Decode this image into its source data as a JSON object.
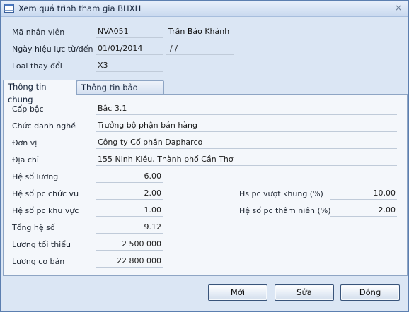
{
  "window": {
    "title": "Xem quá trình tham gia BHXH",
    "close_icon": "×"
  },
  "header": {
    "employee_code_label": "Mã nhân viên",
    "employee_code": "NVA051",
    "employee_name": "Trần Bảo Khánh",
    "effective_date_label": "Ngày hiệu lực từ/đến",
    "effective_from": "01/01/2014",
    "effective_to": "/ /",
    "change_type_label": "Loại thay đổi",
    "change_type": "X3"
  },
  "tabs": [
    {
      "label": "Thông tin chung",
      "active": true
    },
    {
      "label": "Thông tin bảo hiểm",
      "active": false
    }
  ],
  "general": {
    "rank_label": "Cấp bậc",
    "rank": "Bậc 3.1",
    "job_title_label": "Chức danh nghề",
    "job_title": "Trưởng bộ phận bán hàng",
    "unit_label": "Đơn vị",
    "unit": "Công ty Cổ phần Dapharco",
    "address_label": "Địa chỉ",
    "address": "155 Ninh Kiều, Thành phố Cần Thơ",
    "salary_coef_label": "Hệ số lương",
    "salary_coef": "6.00",
    "position_allow_label": "Hệ số pc chức vụ",
    "position_allow": "2.00",
    "region_allow_label": "Hệ số pc khu vực",
    "region_allow": "1.00",
    "total_coef_label": "Tổng hệ số",
    "total_coef": "9.12",
    "min_salary_label": "Lương tối thiểu",
    "min_salary": "2 500 000",
    "base_salary_label": "Lương cơ bản",
    "base_salary": "22 800 000",
    "over_frame_label": "Hs pc vượt khung (%)",
    "over_frame": "10.00",
    "seniority_label": "Hệ số pc thâm niên (%)",
    "seniority": "2.00"
  },
  "buttons": {
    "new_pre": "",
    "new_acc": "M",
    "new_post": "ới",
    "edit_pre": "",
    "edit_acc": "S",
    "edit_post": "ửa",
    "close_pre": "",
    "close_acc": "Đ",
    "close_post": "óng"
  },
  "icons": {
    "app": "table-icon",
    "close": "close-icon"
  }
}
